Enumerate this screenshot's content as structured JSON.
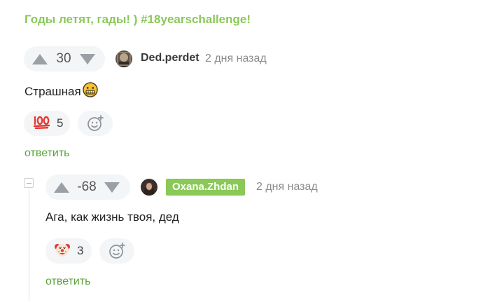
{
  "post": {
    "title": "Годы летят, гады! ) #18yearschallenge!"
  },
  "comments": [
    {
      "rating": "30",
      "author": "Ded.perdet",
      "time": "2 дня назад",
      "text": "Страшная",
      "reaction": {
        "icon": "hundred-points-emoji",
        "count": "5"
      },
      "reply_label": "ответить"
    },
    {
      "rating": "-68",
      "author": "Oxana.Zhdan",
      "time": "2 дня назад",
      "text": "Ага, как жизнь твоя, дед",
      "reaction": {
        "icon": "clown-face-emoji",
        "count": "3"
      },
      "reply_label": "ответить"
    }
  ],
  "colors": {
    "accent": "#8ac858",
    "link": "#5ba33a",
    "pill_bg": "#f3f5f7",
    "arrow": "#9aa0a6",
    "muted": "#8b8b8b"
  }
}
